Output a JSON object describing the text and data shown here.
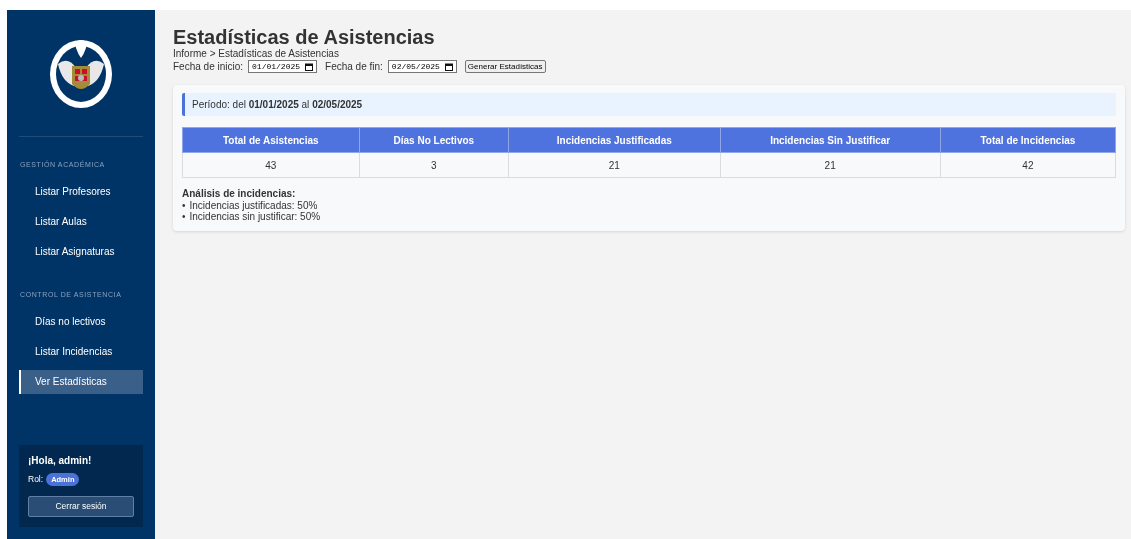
{
  "sidebar": {
    "sections": [
      {
        "heading": "GESTIÓN ACADÉMICA",
        "items": [
          {
            "label": "Listar Profesores",
            "selected": false
          },
          {
            "label": "Listar Aulas",
            "selected": false
          },
          {
            "label": "Listar Asignaturas",
            "selected": false
          }
        ]
      },
      {
        "heading": "CONTROL DE ASISTENCIA",
        "items": [
          {
            "label": "Días no lectivos",
            "selected": false
          },
          {
            "label": "Listar Incidencias",
            "selected": false
          },
          {
            "label": "Ver Estadísticas",
            "selected": true
          }
        ]
      }
    ],
    "user": {
      "greeting": "¡Hola, admin!",
      "role_label": "Rol:",
      "role": "Admin",
      "logout": "Cerrar sesión"
    }
  },
  "page": {
    "title": "Estadísticas de Asistencias",
    "breadcrumb": "Informe > Estadísticas de Asistencias",
    "filters": [
      {
        "label": "Fecha de inicio:",
        "value": "01/01/2025"
      },
      {
        "label": "Fecha de fin:",
        "value": "02/05/2025"
      }
    ],
    "generate_button": "Generar Estadísticas"
  },
  "period": "Período: del **01/01/2025** al **02/05/2025**",
  "table": {
    "columns": [
      "Total de Asistencias",
      "Días No Lectivos",
      "Incidencias Justificadas",
      "Incidencias Sin Justificar",
      "Total de Incidencias"
    ],
    "rows": [
      [
        "43",
        "3",
        "21",
        "21",
        "42"
      ]
    ]
  },
  "analysis": {
    "title": "Análisis de incidencias:",
    "items": [
      {
        "marker": "•",
        "text": "Incidencias justificadas: 50%"
      },
      {
        "marker": "•",
        "text": "Incidencias sin justificar: 50%"
      }
    ]
  }
}
